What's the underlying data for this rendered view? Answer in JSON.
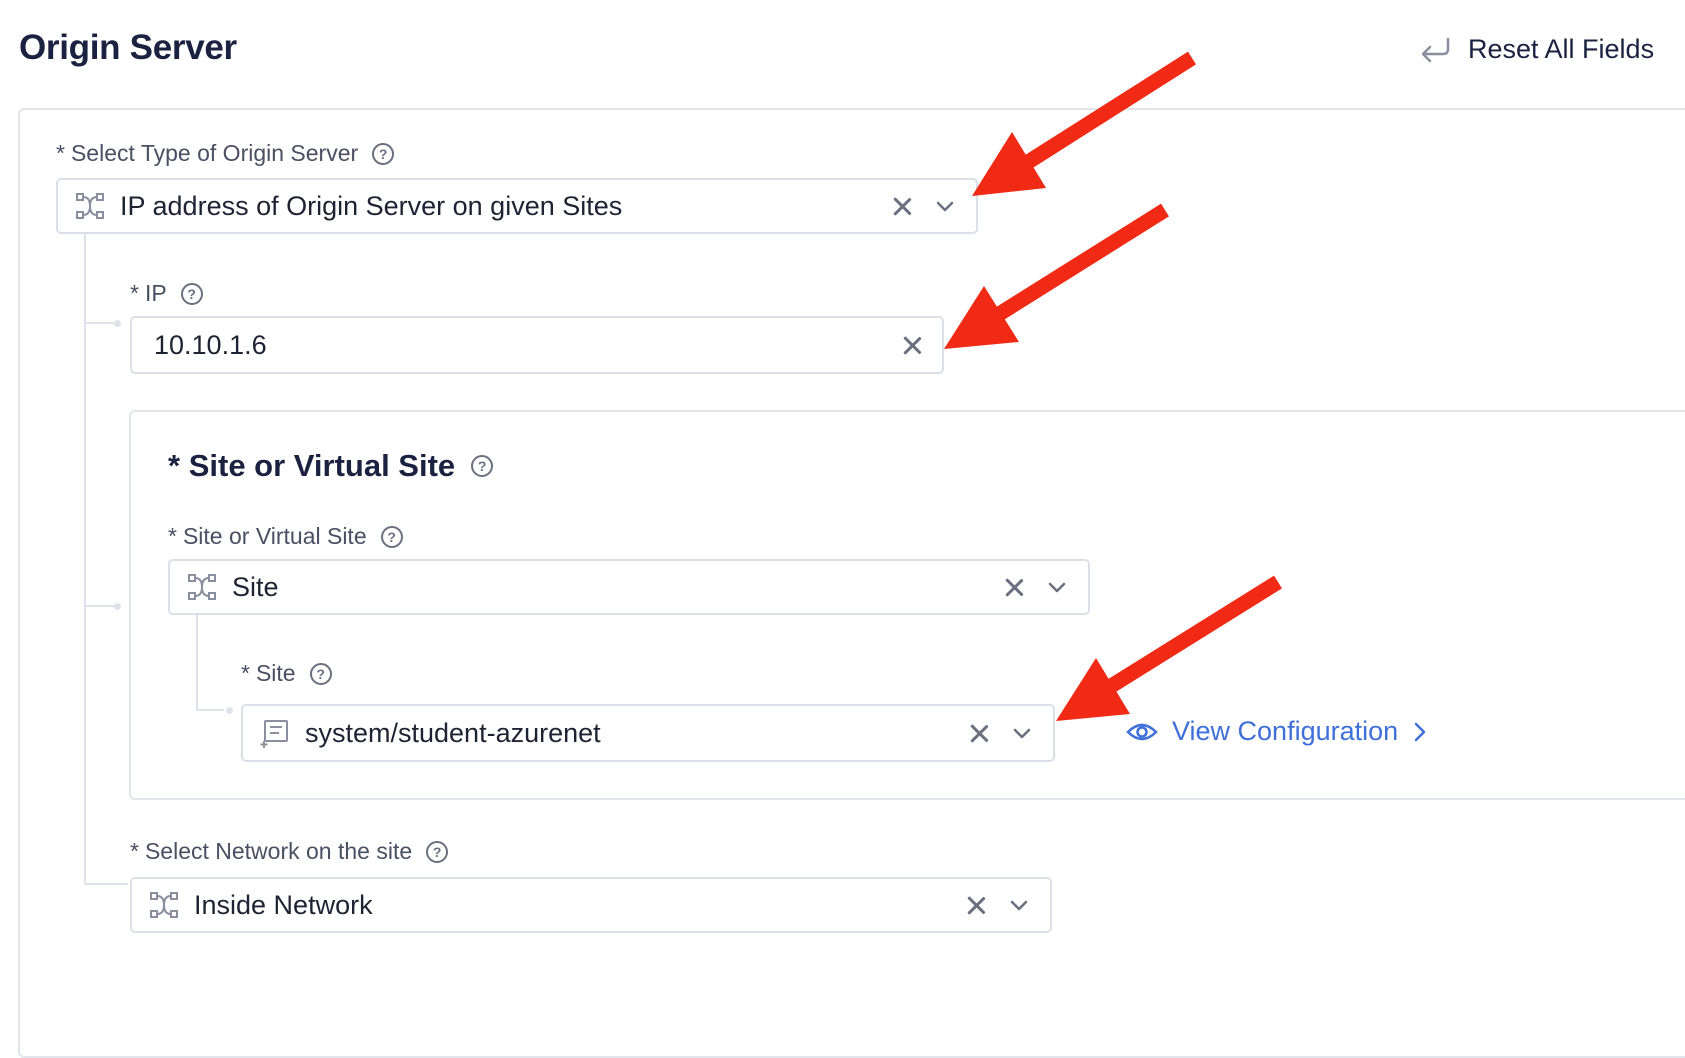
{
  "header": {
    "title": "Origin Server",
    "reset_label": "Reset All Fields"
  },
  "origin_type": {
    "label": "Select Type of Origin Server",
    "required_mark": "*",
    "value": "IP address of Origin Server on given Sites"
  },
  "ip": {
    "label": "IP",
    "required_mark": "*",
    "value": "10.10.1.6"
  },
  "site_section": {
    "title": "Site or Virtual Site",
    "required_mark": "*",
    "type_label": "Site or Virtual Site",
    "type_value": "Site",
    "site_label": "Site",
    "site_value": "system/student-azurenet",
    "view_config": "View Configuration"
  },
  "network": {
    "label": "Select Network on the site",
    "required_mark": "*",
    "value": "Inside Network"
  },
  "icons": {
    "help": "question-circle-icon",
    "selector": "shuffle-icon",
    "site": "list-doc-icon",
    "clear": "close-icon",
    "dropdown": "chevron-down-icon",
    "view": "eye-icon"
  },
  "colors": {
    "accent": "#3f6fd8",
    "annotation_arrow": "#f02a14",
    "title": "#1b2140"
  }
}
